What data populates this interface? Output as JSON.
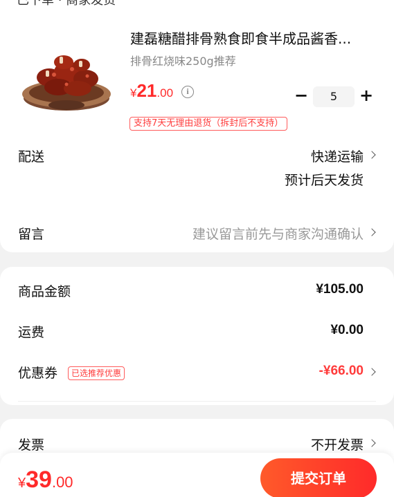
{
  "header": {
    "partial_text": "已下单 · 商家发货"
  },
  "product": {
    "title": "建磊糖醋排骨熟食即食半成品酱香...",
    "spec": "排骨红烧味250g推荐",
    "price_symbol": "¥",
    "price_int": "21",
    "price_dec": ".00",
    "quantity": "5",
    "minus_label": "−",
    "plus_label": "+",
    "info_label": "i",
    "return_policy": "支持7天无理由退货（拆封后不支持）"
  },
  "delivery": {
    "label": "配送",
    "method": "快递运输",
    "estimate": "预计后天发货"
  },
  "message": {
    "label": "留言",
    "placeholder": "建议留言前先与商家沟通确认"
  },
  "summary": {
    "goods_label": "商品金额",
    "goods_value": "¥105.00",
    "shipping_label": "运费",
    "shipping_value": "¥0.00",
    "coupon_label": "优惠券",
    "coupon_tag": "已选推荐优惠",
    "coupon_value": "-¥66.00"
  },
  "invoice": {
    "label": "发票",
    "value": "不开发票"
  },
  "footer": {
    "total_symbol": "¥",
    "total_int": "39",
    "total_dec": ".00",
    "submit_label": "提交订单"
  },
  "colors": {
    "accent": "#ff2a2a",
    "background": "#f2f2f2"
  }
}
